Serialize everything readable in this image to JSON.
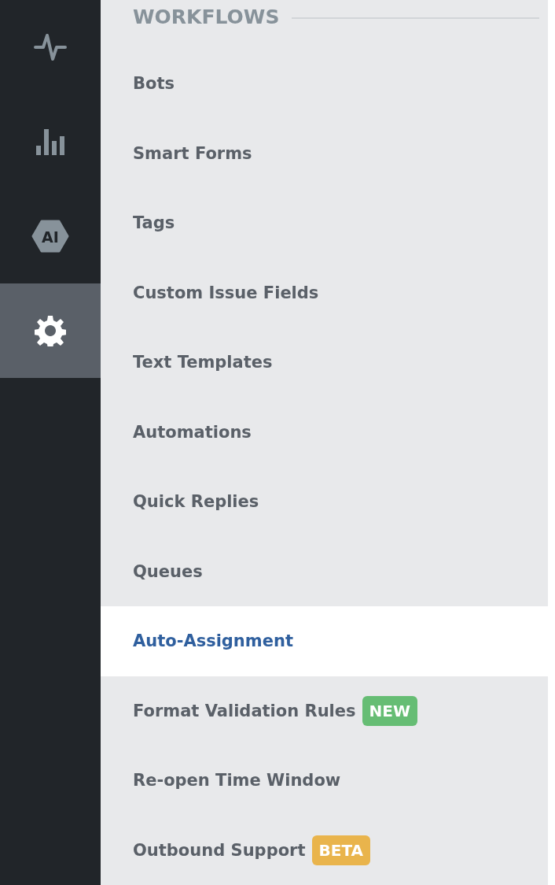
{
  "rail": [
    {
      "kind": "pulse",
      "selected": false
    },
    {
      "kind": "bars",
      "selected": false
    },
    {
      "kind": "ai",
      "label": "AI",
      "selected": false
    },
    {
      "kind": "gear",
      "selected": true
    }
  ],
  "section": {
    "title": "WORKFLOWS"
  },
  "items": [
    {
      "label": "Bots",
      "selected": false
    },
    {
      "label": "Smart Forms",
      "selected": false
    },
    {
      "label": "Tags",
      "selected": false
    },
    {
      "label": "Custom Issue Fields",
      "selected": false
    },
    {
      "label": "Text Templates",
      "selected": false
    },
    {
      "label": "Automations",
      "selected": false
    },
    {
      "label": "Quick Replies",
      "selected": false
    },
    {
      "label": "Queues",
      "selected": false
    },
    {
      "label": "Auto-Assignment",
      "selected": true
    },
    {
      "label": "Format Validation Rules",
      "selected": false,
      "badge": {
        "text": "NEW",
        "color": "#66bd74"
      }
    },
    {
      "label": "Re-open Time Window",
      "selected": false
    },
    {
      "label": "Outbound Support",
      "selected": false,
      "badge": {
        "text": "BETA",
        "color": "#e9b44c"
      }
    }
  ]
}
